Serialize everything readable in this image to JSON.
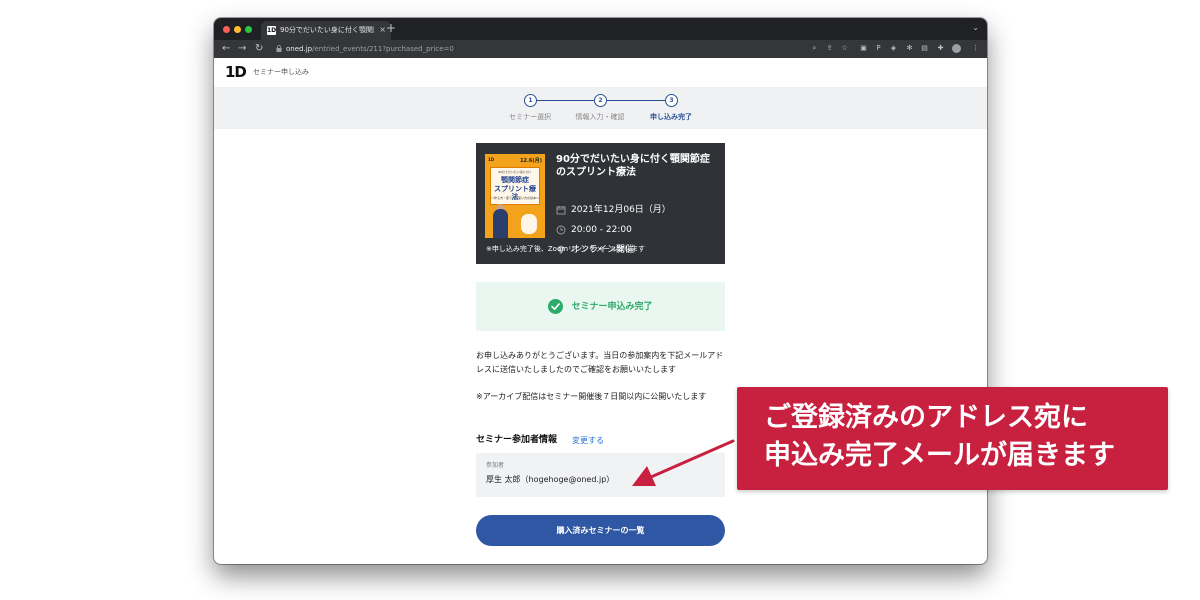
{
  "browser": {
    "tab_favicon": "1D",
    "tab_title": "90分でだいたい身に付く顎関節症",
    "tab_close": "×",
    "new_tab": "+",
    "url_host": "oned.jp",
    "url_path": "/entried_events/211?purchased_price=0"
  },
  "header": {
    "logo": "1D",
    "title": "セミナー申し込み"
  },
  "stepper": {
    "steps": [
      {
        "number": "1",
        "label": "セミナー選択"
      },
      {
        "number": "2",
        "label": "情報入力・確認"
      },
      {
        "number": "3",
        "label": "申し込み完了"
      }
    ],
    "accent": "#2a4f95"
  },
  "event": {
    "thumbnail": {
      "brand": "1D",
      "date": "12.6(月)",
      "subtitle": "90分でだいたい身に付く",
      "title_line1": "顎関節症",
      "title_line2": "スプリント療法",
      "tagline": "〜作る方・使う方・使い方の基本〜"
    },
    "title": "90分でだいたい身に付く顎関節症のスプリント療法",
    "date": "2021年12月06日（月）",
    "time": "20:00 - 22:00",
    "location": "オンライン開催",
    "note": "※申し込み完了後、Zoomリンクをメール致します"
  },
  "success": {
    "message": "セミナー申込み完了",
    "color": "#2eaa6a"
  },
  "messages": {
    "thanks": "お申し込みありがとうございます。当日の参加案内を下記メールアドレスに送信いたしましたのでご確認をお願いいたします",
    "archive": "※アーカイブ配信はセミナー開催後７日間以内に公開いたします"
  },
  "participant_section": {
    "title": "セミナー参加者情報",
    "edit_link": "変更する",
    "label": "参加者",
    "value": "厚生 太郎（hogehoge@oned.jp）"
  },
  "purchase_button": {
    "label": "購入済みセミナーの一覧"
  },
  "callout": {
    "line1": "ご登録済みのアドレス宛に",
    "line2": "申込み完了メールが届きます",
    "color": "#c8203f"
  }
}
